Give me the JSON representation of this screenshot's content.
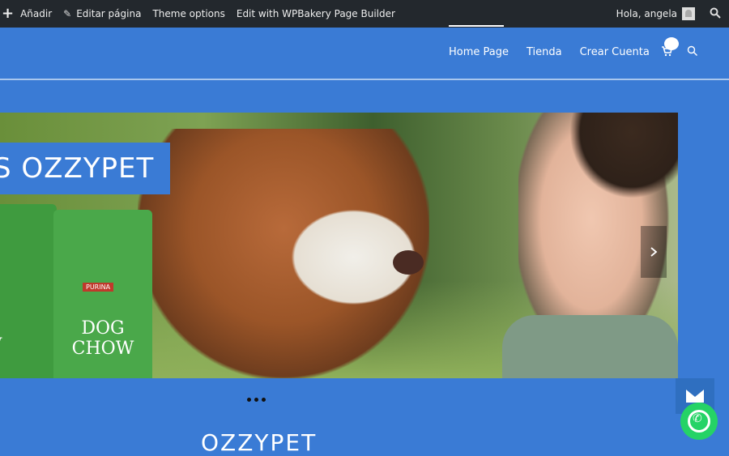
{
  "adminbar": {
    "add_label": "Añadir",
    "edit_page_label": "Editar página",
    "theme_options_label": "Theme options",
    "wpbakery_label": "Edit with WPBakery Page Builder",
    "greeting": "Hola, angela"
  },
  "nav": {
    "items": [
      "Home Page",
      "Tienda",
      "Crear Cuenta"
    ]
  },
  "slider": {
    "banner_text": "S OZZYPET",
    "bag1_label": "W",
    "bag2_label": "DOG CHOW",
    "bag2_brand": "PURINA",
    "active_dot": 0,
    "dot_count": 4
  },
  "site": {
    "title": "OZZYPET"
  },
  "colors": {
    "primary": "#3a7bd5",
    "adminbar": "#23282d",
    "whatsapp": "#25d366"
  }
}
